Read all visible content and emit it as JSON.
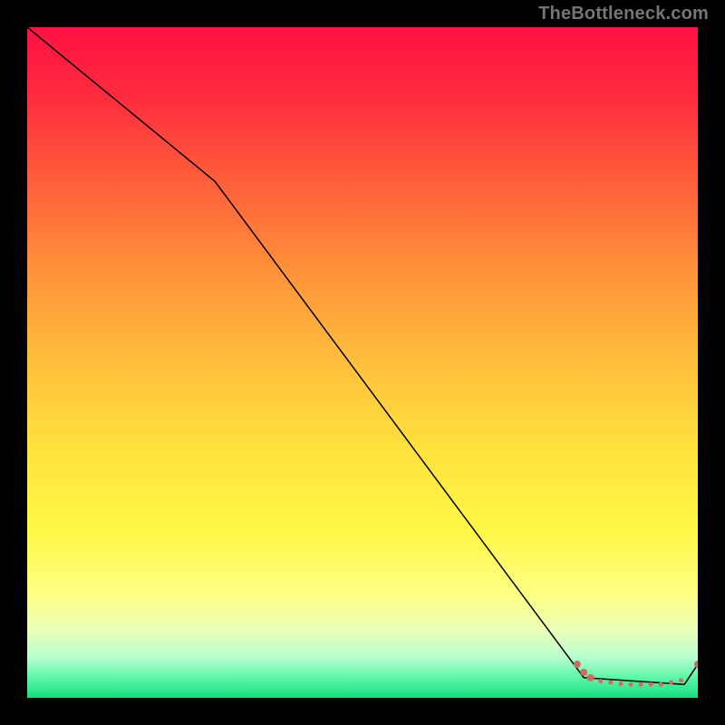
{
  "watermark": "TheBottleneck.com",
  "chart_data": {
    "type": "line",
    "title": "",
    "xlabel": "",
    "ylabel": "",
    "xlim": [
      0,
      100
    ],
    "ylim": [
      0,
      100
    ],
    "series": [
      {
        "name": "bottleneck-curve",
        "x": [
          0,
          28,
          83,
          98,
          100
        ],
        "y": [
          100,
          77,
          3,
          2,
          5
        ]
      }
    ],
    "markers": {
      "name": "highlight-points",
      "color": "#d06a63",
      "points": [
        {
          "x": 82.0,
          "y": 5.0,
          "r": 4
        },
        {
          "x": 83.0,
          "y": 3.8,
          "r": 4
        },
        {
          "x": 84.0,
          "y": 3.0,
          "r": 4
        },
        {
          "x": 85.5,
          "y": 2.5,
          "r": 2.5
        },
        {
          "x": 87.0,
          "y": 2.3,
          "r": 2.5
        },
        {
          "x": 88.5,
          "y": 2.1,
          "r": 2.5
        },
        {
          "x": 90.0,
          "y": 2.0,
          "r": 2.5
        },
        {
          "x": 91.5,
          "y": 2.0,
          "r": 2.5
        },
        {
          "x": 93.0,
          "y": 2.0,
          "r": 2.5
        },
        {
          "x": 94.5,
          "y": 2.0,
          "r": 2.5
        },
        {
          "x": 96.0,
          "y": 2.3,
          "r": 2.5
        },
        {
          "x": 97.5,
          "y": 2.6,
          "r": 2.5
        },
        {
          "x": 100.0,
          "y": 5.0,
          "r": 4
        }
      ]
    },
    "gradient_stops": [
      {
        "pos": 0.0,
        "color": "#ff1242"
      },
      {
        "pos": 0.5,
        "color": "#ffcc3d"
      },
      {
        "pos": 0.8,
        "color": "#fff95a"
      },
      {
        "pos": 1.0,
        "color": "#13e07d"
      }
    ]
  }
}
